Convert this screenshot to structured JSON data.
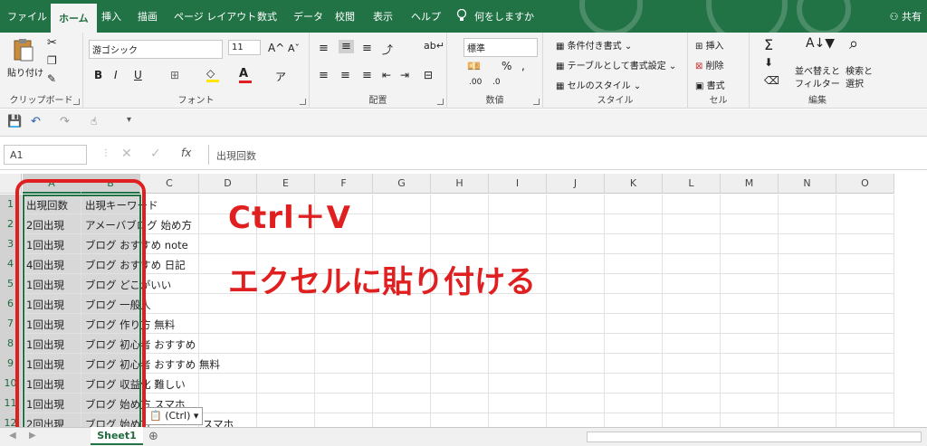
{
  "tabs": [
    "ファイル",
    "ホーム",
    "挿入",
    "描画",
    "ページ レイアウト",
    "数式",
    "データ",
    "校閲",
    "表示",
    "ヘルプ"
  ],
  "tell_me": "何をしますか",
  "share": "共有",
  "ribbon": {
    "clipboard": {
      "paste": "貼り付け",
      "label": "クリップボード"
    },
    "font": {
      "name": "游ゴシック",
      "size": "11",
      "label": "フォント",
      "bold": "B",
      "italic": "I",
      "underline": "U"
    },
    "alignment": {
      "label": "配置"
    },
    "number": {
      "format": "標準",
      "label": "数値"
    },
    "styles": {
      "conditional": "条件付き書式",
      "as_table": "テーブルとして書式設定",
      "cell_styles": "セルのスタイル",
      "label": "スタイル"
    },
    "cells": {
      "insert": "挿入",
      "delete": "削除",
      "format": "書式",
      "label": "セル"
    },
    "editing": {
      "sort": "並べ替えと",
      "filter": "フィルター",
      "find": "検索と",
      "select": "選択",
      "label": "編集"
    }
  },
  "formula_bar": {
    "name_box": "A1",
    "content": "出現回数",
    "fx": "fx"
  },
  "columns": [
    "A",
    "B",
    "C",
    "D",
    "E",
    "F",
    "G",
    "H",
    "I",
    "J",
    "K",
    "L",
    "M",
    "N",
    "O"
  ],
  "rows": [
    {
      "num": "1",
      "a": "出現回数",
      "b": "出現キーワード"
    },
    {
      "num": "2",
      "a": "2回出現",
      "b": "アメーバブログ 始め方"
    },
    {
      "num": "3",
      "a": "1回出現",
      "b": "ブログ おすすめ note"
    },
    {
      "num": "4",
      "a": "4回出現",
      "b": "ブログ おすすめ 日記"
    },
    {
      "num": "5",
      "a": "1回出現",
      "b": "ブログ どこがいい"
    },
    {
      "num": "6",
      "a": "1回出現",
      "b": "ブログ 一般人"
    },
    {
      "num": "7",
      "a": "1回出現",
      "b": "ブログ 作り方 無料"
    },
    {
      "num": "8",
      "a": "1回出現",
      "b": "ブログ 初心者 おすすめ"
    },
    {
      "num": "9",
      "a": "1回出現",
      "b": "ブログ 初心者 おすすめ 無料"
    },
    {
      "num": "10",
      "a": "1回出現",
      "b": "ブログ 収益化 難しい"
    },
    {
      "num": "11",
      "a": "1回出現",
      "b": "ブログ 始め方 スマホ"
    },
    {
      "num": "12",
      "a": "2回出現",
      "b": "ブログ 始め方"
    }
  ],
  "row12_extra": "スマホ",
  "paste_options": "(Ctrl)",
  "annotation_shortcut": "Ctrl＋V",
  "annotation_text": "エクセルに貼り付ける",
  "sheet_tab": "Sheet1",
  "colors": {
    "excel_green": "#217346",
    "annotation_red": "#e02020"
  }
}
